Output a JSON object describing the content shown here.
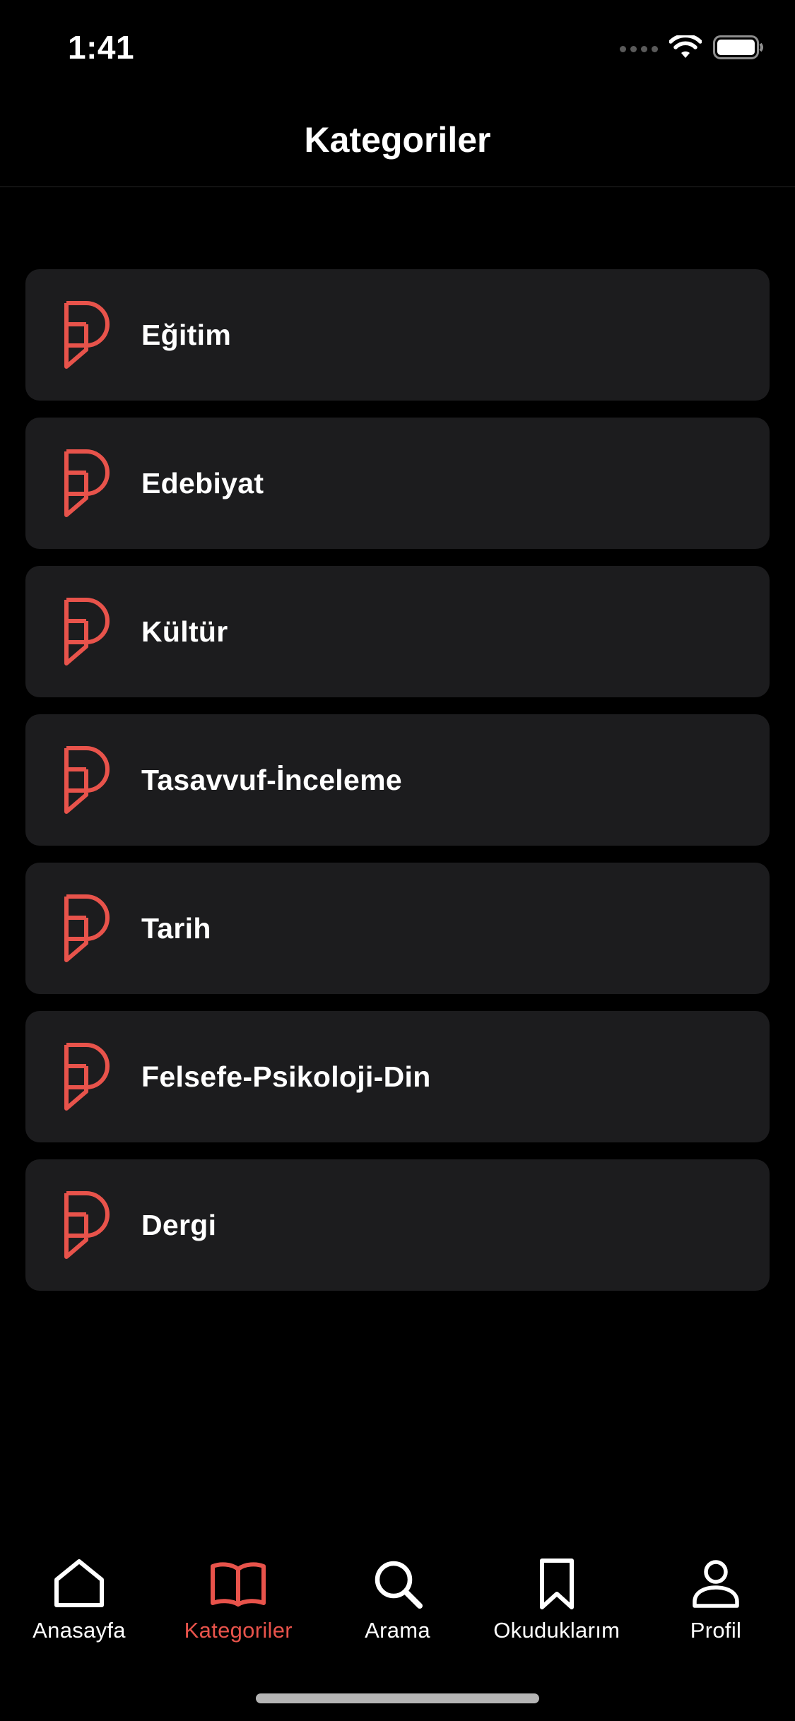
{
  "status_bar": {
    "time": "1:41"
  },
  "header": {
    "title": "Kategoriler"
  },
  "colors": {
    "accent": "#e8534b",
    "background": "#000000",
    "card": "#1c1c1e",
    "text": "#ffffff"
  },
  "categories": [
    {
      "label": "Eğitim",
      "icon": "brand-logo-icon"
    },
    {
      "label": "Edebiyat",
      "icon": "brand-logo-icon"
    },
    {
      "label": "Kültür",
      "icon": "brand-logo-icon"
    },
    {
      "label": "Tasavvuf-İnceleme",
      "icon": "brand-logo-icon"
    },
    {
      "label": "Tarih",
      "icon": "brand-logo-icon"
    },
    {
      "label": "Felsefe-Psikoloji-Din",
      "icon": "brand-logo-icon"
    },
    {
      "label": "Dergi",
      "icon": "brand-logo-icon"
    }
  ],
  "tab_bar": {
    "active": "Kategoriler",
    "tabs": [
      {
        "label": "Anasayfa",
        "icon": "home-icon"
      },
      {
        "label": "Kategoriler",
        "icon": "book-icon"
      },
      {
        "label": "Arama",
        "icon": "search-icon"
      },
      {
        "label": "Okuduklarım",
        "icon": "bookmark-icon"
      },
      {
        "label": "Profil",
        "icon": "person-icon"
      }
    ]
  }
}
